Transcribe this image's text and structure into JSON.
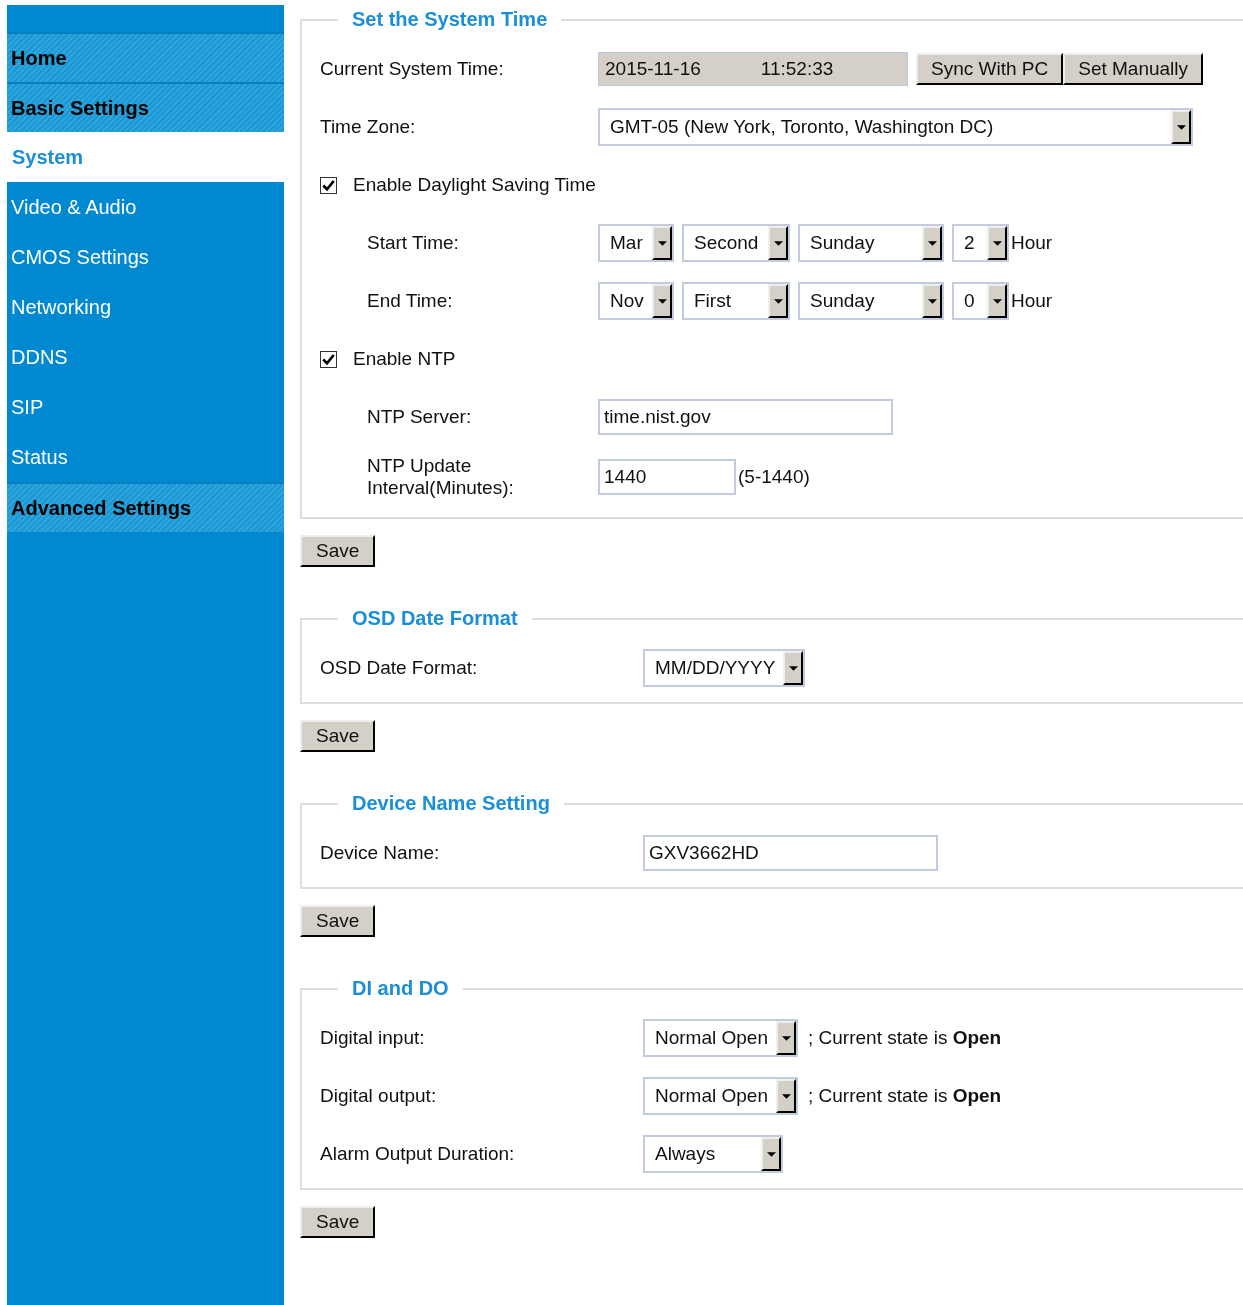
{
  "sidebar": {
    "items": [
      {
        "label": "Home",
        "kind": "header",
        "selected": false
      },
      {
        "label": "Basic Settings",
        "kind": "header",
        "selected": false
      },
      {
        "label": "System",
        "kind": "link",
        "selected": true
      },
      {
        "label": "Video & Audio",
        "kind": "link",
        "selected": false
      },
      {
        "label": "CMOS Settings",
        "kind": "link",
        "selected": false
      },
      {
        "label": "Networking",
        "kind": "link",
        "selected": false
      },
      {
        "label": "DDNS",
        "kind": "link",
        "selected": false
      },
      {
        "label": "SIP",
        "kind": "link",
        "selected": false
      },
      {
        "label": "Status",
        "kind": "link",
        "selected": false
      },
      {
        "label": "Advanced Settings",
        "kind": "header",
        "selected": false
      }
    ]
  },
  "sections": [
    {
      "legend": "Set the System Time",
      "save_button": "Save",
      "rows": [
        {
          "kind": "readout",
          "label": "Current System Time:",
          "date": "2015-11-16",
          "time": "11:52:33",
          "buttons": [
            "Sync With PC",
            "Set Manually"
          ]
        },
        {
          "kind": "select",
          "label": "Time Zone:",
          "value": "GMT-05 (New York, Toronto, Washington DC)"
        },
        {
          "kind": "checkbox",
          "label": "Enable Daylight Saving Time",
          "checked": true
        },
        {
          "kind": "selects",
          "label": "Start Time:",
          "values": [
            "Mar",
            "Second",
            "Sunday",
            "2"
          ],
          "suffix": "Hour"
        },
        {
          "kind": "selects",
          "label": "End Time:",
          "values": [
            "Nov",
            "First",
            "Sunday",
            "0"
          ],
          "suffix": "Hour"
        },
        {
          "kind": "checkbox",
          "label": "Enable NTP",
          "checked": true
        },
        {
          "kind": "input",
          "label": "NTP Server:",
          "value": "time.nist.gov"
        },
        {
          "kind": "input",
          "label": "NTP Update Interval(Minutes):",
          "value": "1440",
          "hint": "(5-1440)"
        }
      ]
    },
    {
      "legend": "OSD Date Format",
      "save_button": "Save",
      "rows": [
        {
          "kind": "select",
          "label": "OSD Date Format:",
          "value": "MM/DD/YYYY"
        }
      ]
    },
    {
      "legend": "Device Name Setting",
      "save_button": "Save",
      "rows": [
        {
          "kind": "input",
          "label": "Device Name:",
          "value": "GXV3662HD"
        }
      ]
    },
    {
      "legend": "DI and DO",
      "save_button": "Save",
      "rows": [
        {
          "kind": "select",
          "label": "Digital input:",
          "value": "Normal Open",
          "note": "; Current state is **Open**"
        },
        {
          "kind": "select",
          "label": "Digital output:",
          "value": "Normal Open",
          "note": "; Current state is **Open**"
        },
        {
          "kind": "select",
          "label": "Alarm Output Duration:",
          "value": "Always"
        }
      ]
    }
  ]
}
